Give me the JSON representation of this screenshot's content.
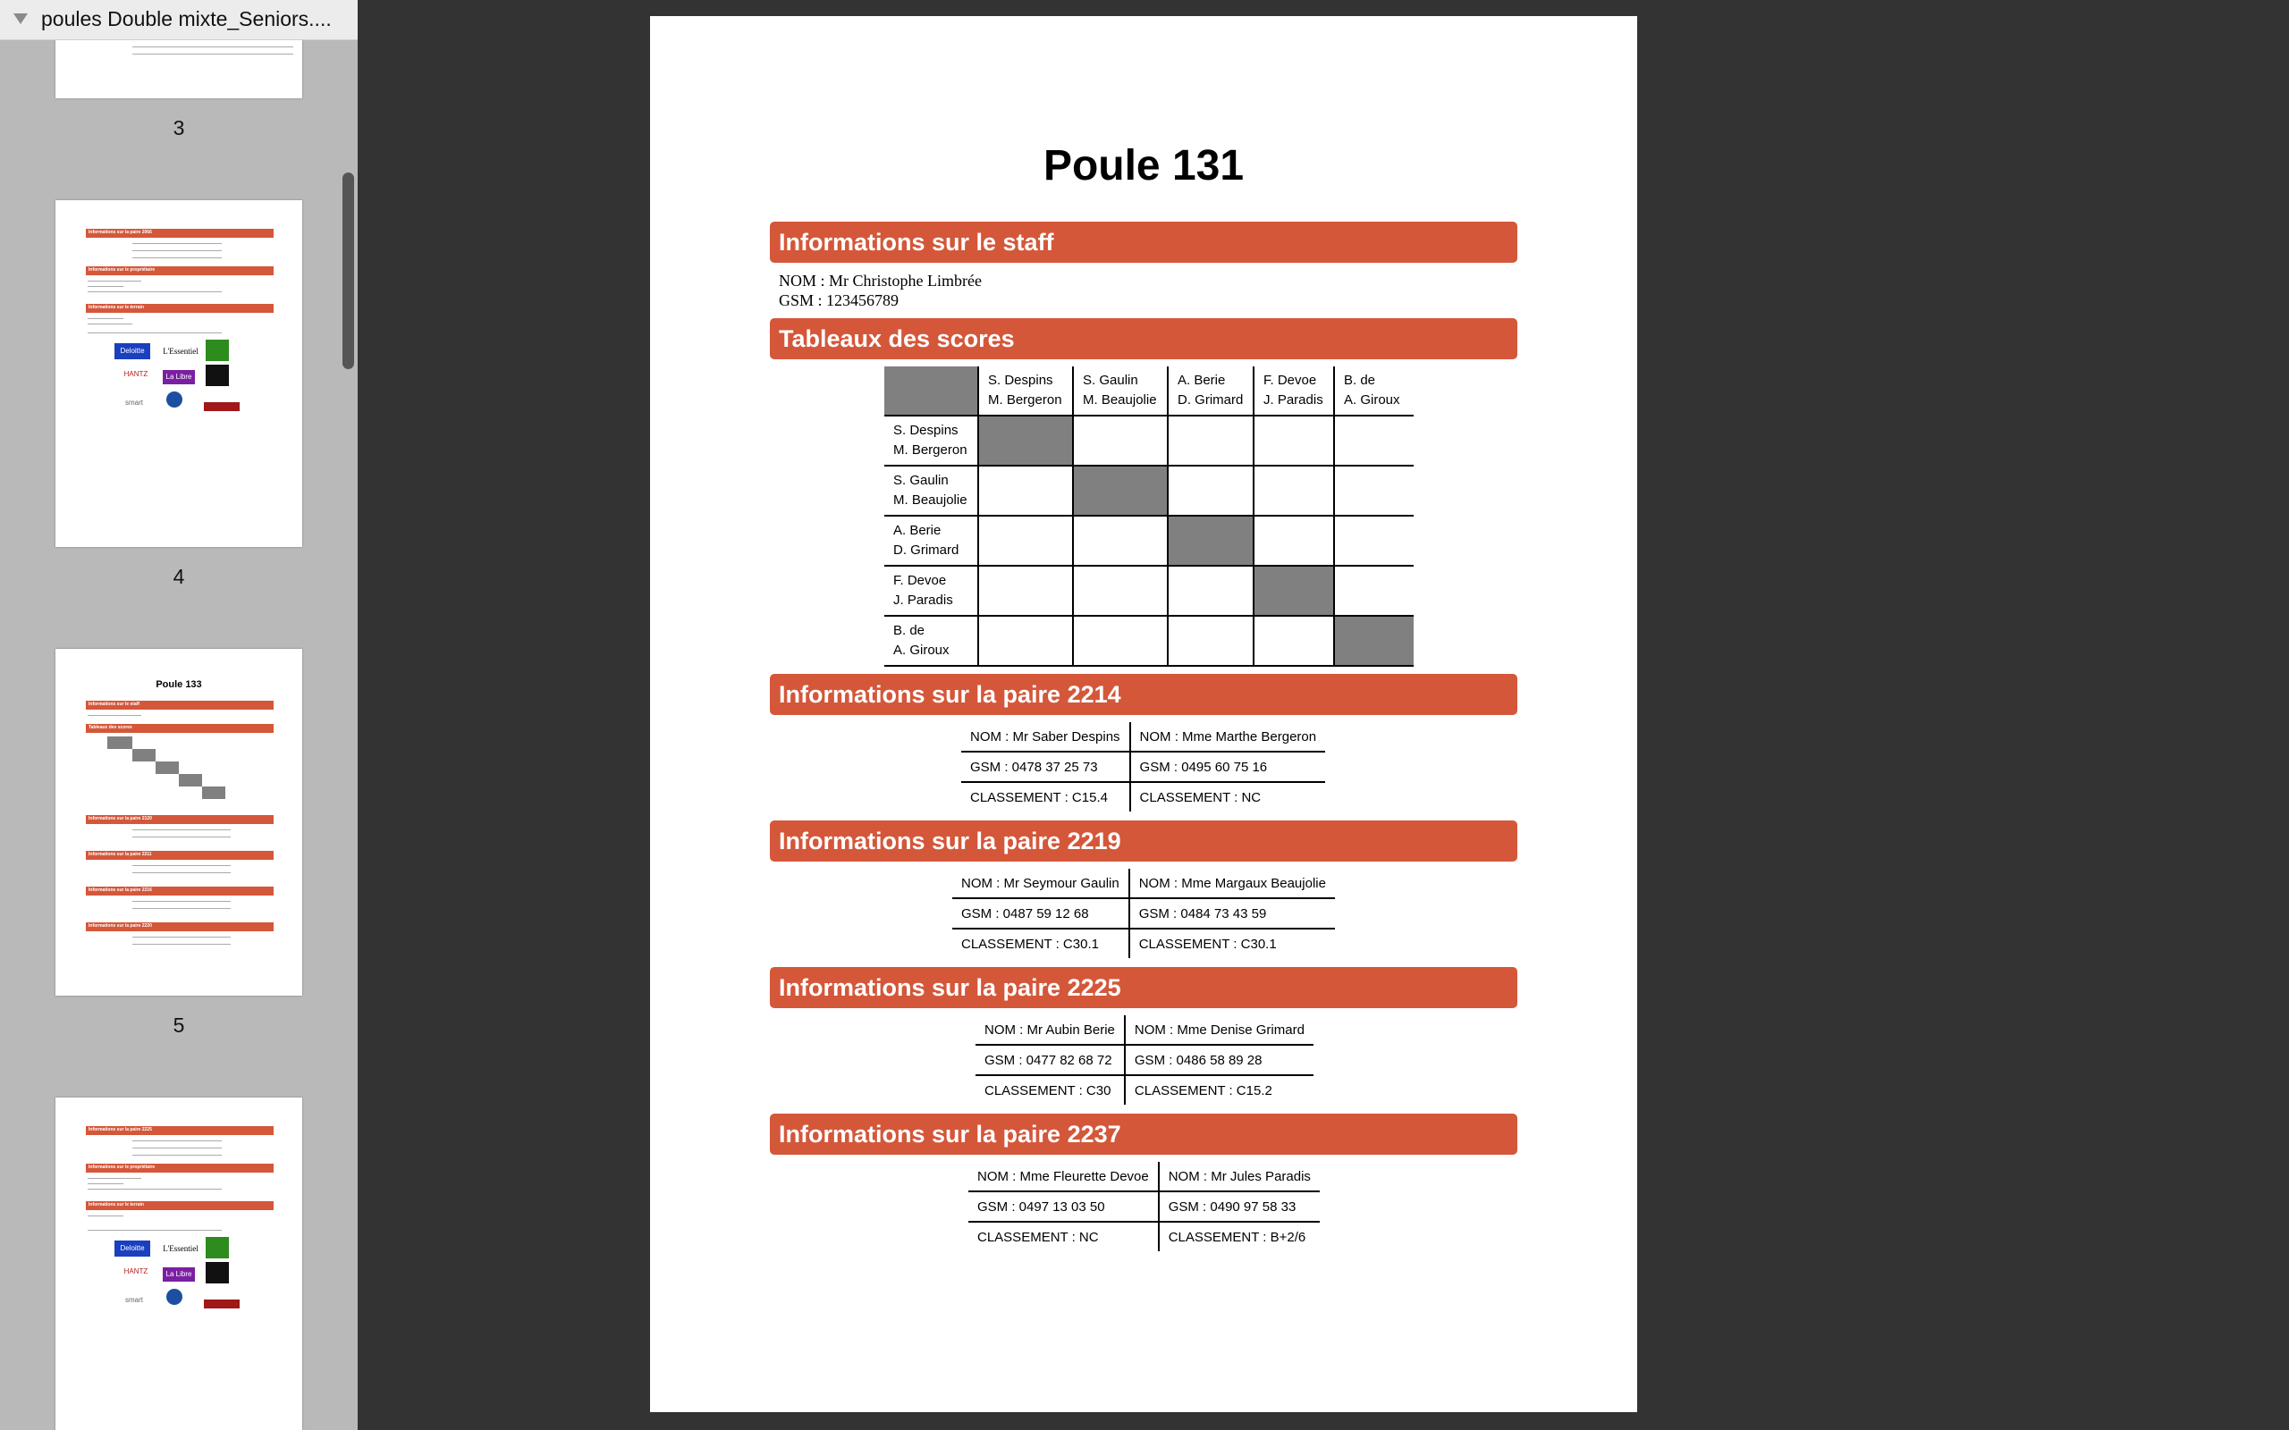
{
  "sidebar": {
    "document_title": "poules Double mixte_Seniors....",
    "pages": [
      {
        "number": "3"
      },
      {
        "number": "4"
      },
      {
        "number": "5"
      }
    ],
    "thumbs": {
      "p4_bars": [
        "Informations sur la paire 2066",
        "Informations sur le propriétaire",
        "Informations sur le terrain"
      ],
      "p5_title": "Poule 133",
      "p5_bars": [
        "Informations sur le staff",
        "Tableaux des scores",
        "Informations sur la paire 2120",
        "Informations sur la paire 2211",
        "Informations sur la paire 2216",
        "Informations sur la paire 2220"
      ],
      "p6_bars": [
        "Informations sur la paire 2225",
        "Informations sur le propriétaire",
        "Informations sur le terrain"
      ],
      "logos": [
        "Deloitte",
        "L'Essentiel",
        "HANTZ",
        "La Libre",
        "smart",
        "VW",
        "Allied Nissan"
      ]
    }
  },
  "document": {
    "title": "Poule 131",
    "staff_section": "Informations sur le staff",
    "staff_name": "NOM : Mr Christophe Limbrée",
    "staff_gsm": "GSM : 123456789",
    "scores_section": "Tableaux des scores",
    "players": [
      {
        "line1": "S. Despins",
        "line2": "M. Bergeron"
      },
      {
        "line1": "S. Gaulin",
        "line2": "M. Beaujolie"
      },
      {
        "line1": "A. Berie",
        "line2": "D. Grimard"
      },
      {
        "line1": "F. Devoe",
        "line2": "J. Paradis"
      },
      {
        "line1": "B. de",
        "line2": "A. Giroux"
      }
    ],
    "pairs": [
      {
        "section": "Informations sur la paire 2214",
        "p1_name": "NOM : Mr Saber Despins",
        "p2_name": "NOM : Mme Marthe Bergeron",
        "p1_gsm": "GSM : 0478 37 25 73",
        "p2_gsm": "GSM : 0495 60 75 16",
        "p1_rank": "CLASSEMENT : C15.4",
        "p2_rank": "CLASSEMENT : NC"
      },
      {
        "section": "Informations sur la paire 2219",
        "p1_name": "NOM : Mr Seymour Gaulin",
        "p2_name": "NOM : Mme Margaux Beaujolie",
        "p1_gsm": "GSM : 0487 59 12 68",
        "p2_gsm": "GSM : 0484 73 43 59",
        "p1_rank": "CLASSEMENT : C30.1",
        "p2_rank": "CLASSEMENT : C30.1"
      },
      {
        "section": "Informations sur la paire 2225",
        "p1_name": "NOM : Mr Aubin Berie",
        "p2_name": "NOM : Mme Denise Grimard",
        "p1_gsm": "GSM : 0477 82 68 72",
        "p2_gsm": "GSM : 0486 58 89 28",
        "p1_rank": "CLASSEMENT : C30",
        "p2_rank": "CLASSEMENT : C15.2"
      },
      {
        "section": "Informations sur la paire 2237",
        "p1_name": "NOM : Mme Fleurette Devoe",
        "p2_name": "NOM : Mr Jules Paradis",
        "p1_gsm": "GSM : 0497 13 03 50",
        "p2_gsm": "GSM : 0490 97 58 33",
        "p1_rank": "CLASSEMENT : NC",
        "p2_rank": "CLASSEMENT : B+2/6"
      }
    ]
  },
  "colors": {
    "section_bar": "#d4573a",
    "grey_cell": "#808080",
    "sidebar_bg": "#b9b9b9",
    "viewer_bg": "#333333"
  }
}
